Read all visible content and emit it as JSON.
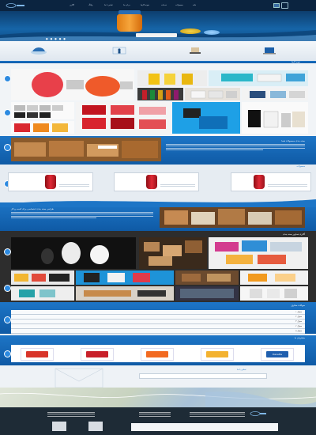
{
  "nav": {
    "menu": [
      "خانه",
      "محصولات",
      "خدمات",
      "نمونه کارها",
      "درباره ما",
      "تماس با ما",
      "وبلاگ",
      "گالری"
    ],
    "lang": "FA"
  },
  "hero": {
    "button_label": "",
    "dots": "● ● ● ● ●"
  },
  "sections": {
    "portfolio_title": "نمونه کارها",
    "packaging_title": "بسته بندی محصولات شما",
    "products_title": "محصولات",
    "custom_title": "طراحی بسته بندی اختصاصی برای کسب و کار",
    "gallery_title": "گالری تصاویر بسته بندی",
    "faq_title": "سوالات متداول",
    "clients_title": "مشتریان ما",
    "contact_title": "تماس با ما"
  },
  "faq": {
    "rows": [
      "سوال ۱",
      "سوال ۲",
      "سوال ۳",
      "سوال ۴",
      "سوال ۵"
    ]
  },
  "clients": [
    "Brand",
    "Brand",
    "Brand",
    "Brand",
    "Danette"
  ],
  "colors": {
    "primary": "#1d75c6",
    "dark": "#0b2440",
    "accent": "#e02a36",
    "orange": "#f6a53b"
  }
}
